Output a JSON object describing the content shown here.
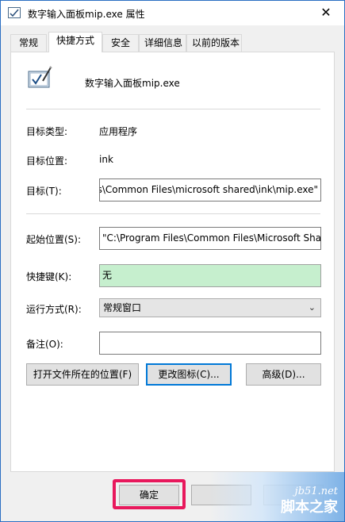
{
  "window": {
    "title_name": "数字输入面板mip.exe",
    "title_suffix": "属性",
    "close_glyph": "✕"
  },
  "tabs": [
    {
      "label": "常规"
    },
    {
      "label": "快捷方式"
    },
    {
      "label": "安全"
    },
    {
      "label": "详细信息"
    },
    {
      "label": "以前的版本"
    }
  ],
  "header": {
    "app_name": "数字输入面板mip.exe",
    "icon": "math-input-panel-icon"
  },
  "fields": {
    "target_type_label": "目标类型:",
    "target_type_value": "应用程序",
    "target_location_label": "目标位置:",
    "target_location_value": "ink",
    "target_label": "目标(T):",
    "target_value": "\"C:\\Program Files\\Common Files\\microsoft shared\\ink\\mip.exe\"",
    "start_in_label": "起始位置(S):",
    "start_in_value": "\"C:\\Program Files\\Common Files\\Microsoft Shared\\ink\"",
    "shortcut_key_label": "快捷键(K):",
    "shortcut_key_value": "无",
    "run_label": "运行方式(R):",
    "run_value": "常规窗口",
    "comment_label": "备注(O):",
    "comment_value": ""
  },
  "buttons": {
    "open_location": "打开文件所在的位置(F)",
    "change_icon": "更改图标(C)...",
    "advanced": "高级(D)...",
    "ok": "确定",
    "cancel": "",
    "apply": ""
  },
  "watermark": {
    "domain": "jb51.net",
    "name": "脚本之家"
  },
  "colors": {
    "highlight": "#e8185c",
    "shortcut_bg": "#c6efce",
    "focus": "#0078d7"
  }
}
